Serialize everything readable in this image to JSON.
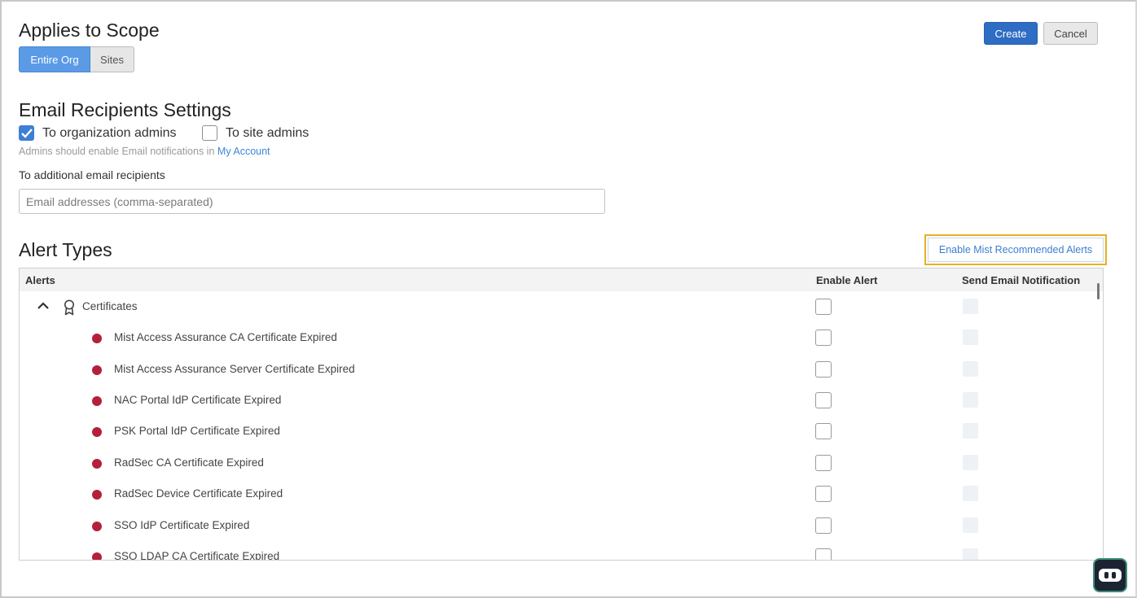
{
  "scope": {
    "title": "Applies to Scope",
    "options": [
      "Entire Org",
      "Sites"
    ],
    "selected": "Entire Org"
  },
  "actions": {
    "create": "Create",
    "cancel": "Cancel"
  },
  "email": {
    "title": "Email Recipients Settings",
    "org_admins_label": "To organization admins",
    "org_admins_checked": true,
    "site_admins_label": "To site admins",
    "site_admins_checked": false,
    "helper_text": "Admins should enable Email notifications in",
    "helper_link": "My Account",
    "additional_label": "To additional email recipients",
    "additional_placeholder": "Email addresses (comma-separated)",
    "additional_value": ""
  },
  "alerts": {
    "title": "Alert Types",
    "recommended_button": "Enable Mist Recommended Alerts",
    "columns": [
      "Alerts",
      "Enable Alert",
      "Send Email Notification"
    ],
    "group": {
      "label": "Certificates",
      "icon": "ribbon-icon",
      "expanded": true
    },
    "items": [
      "Mist Access Assurance CA Certificate Expired",
      "Mist Access Assurance Server Certificate Expired",
      "NAC Portal IdP Certificate Expired",
      "PSK Portal IdP Certificate Expired",
      "RadSec CA Certificate Expired",
      "RadSec Device Certificate Expired",
      "SSO IdP Certificate Expired",
      "SSO LDAP CA Certificate Expired"
    ],
    "severity_color": "#b3203c"
  },
  "colors": {
    "primary": "#2f6dc4",
    "selected_segment": "#5b9be6",
    "highlight": "#e7b024",
    "link": "#3b86d8"
  }
}
